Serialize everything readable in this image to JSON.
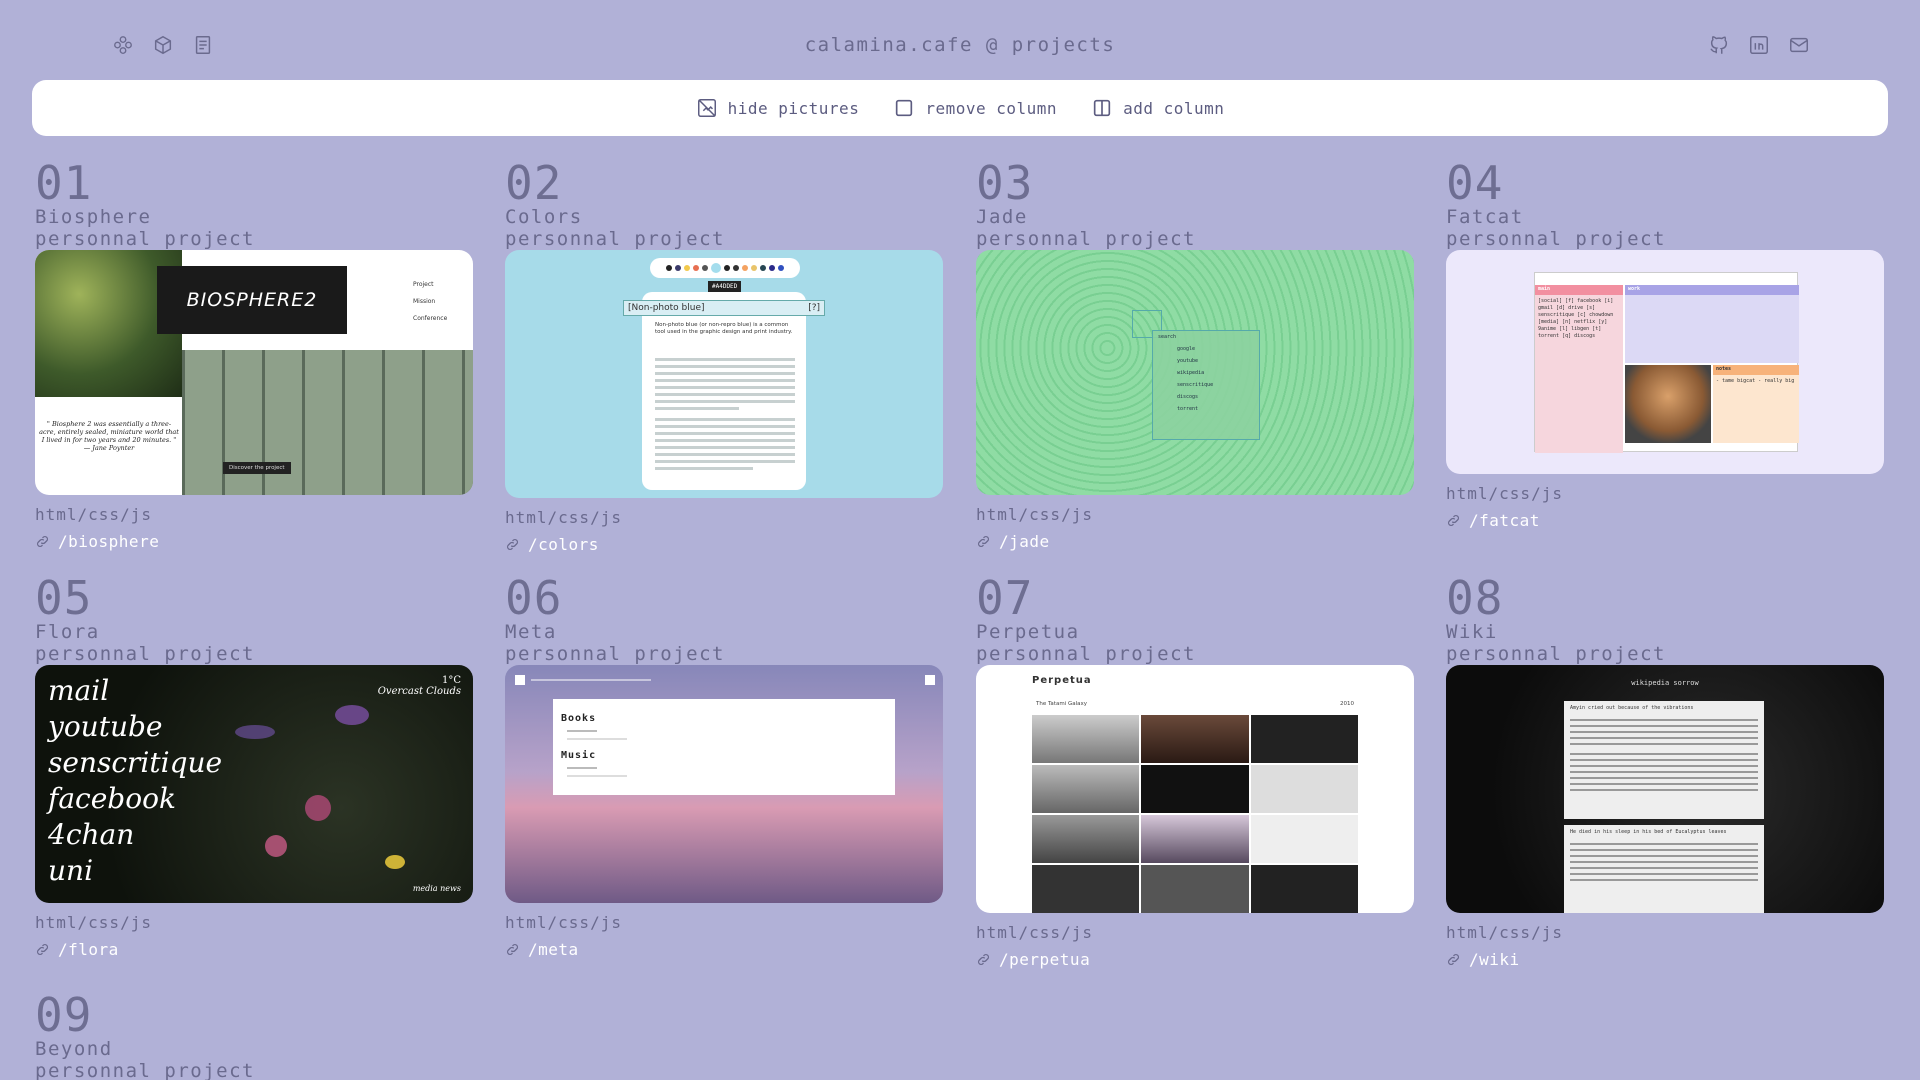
{
  "header": {
    "title": "calamina.cafe @ projects",
    "left_icons": [
      "flower-icon",
      "cube-icon",
      "document-icon"
    ],
    "social_icons": [
      "github-icon",
      "linkedin-icon",
      "mail-icon"
    ]
  },
  "toolbar": {
    "hide_pictures": "hide pictures",
    "remove_column": "remove column",
    "add_column": "add column"
  },
  "projects": [
    {
      "num": "01",
      "name": "Biosphere",
      "type": "personnal project",
      "tech": "html/css/js",
      "link": "/biosphere",
      "thumb": {
        "logo": "BIOSPHERE2",
        "menu": [
          "Project",
          "Mission",
          "Conference"
        ],
        "quote": "\" Biosphere 2 was essentially a three-acre, entirely sealed, miniature world that I lived in for two years and 20 minutes. \" — Jane Poynter",
        "button": "Discover the project"
      }
    },
    {
      "num": "02",
      "name": "Colors",
      "type": "personnal project",
      "tech": "html/css/js",
      "link": "/colors",
      "thumb": {
        "hex": "#A4DDED",
        "label": "[Non-photo blue]",
        "help": "[?]",
        "caption": "Non-photo blue (or non-repro blue) is a common tool used in the graphic design and print industry."
      }
    },
    {
      "num": "03",
      "name": "Jade",
      "type": "personnal project",
      "tech": "html/css/js",
      "link": "/jade",
      "thumb": {
        "search": "search",
        "items": [
          "google",
          "youtube",
          "wikipedia",
          "senscritique",
          "discogs",
          "torrent"
        ]
      }
    },
    {
      "num": "04",
      "name": "Fatcat",
      "type": "personnal project",
      "tech": "html/css/js",
      "link": "/fatcat",
      "thumb": {
        "main": "main",
        "work": "work",
        "notes": "notes",
        "main_items": "[social] [f] facebook [i] gmail [d] drive [s] senscritique [c] chowdown [media] [n] netflix [y] 9anime [l] libgen [t] torrent [q] discogs",
        "notes_text": "- tame bigcat - really big"
      }
    },
    {
      "num": "05",
      "name": "Flora",
      "type": "personnal project",
      "tech": "html/css/js",
      "link": "/flora",
      "thumb": {
        "links": [
          "mail",
          "youtube",
          "senscritique",
          "facebook",
          "4chan",
          "uni"
        ],
        "temp": "1°C",
        "weather": "Overcast Clouds",
        "footer": "media   news"
      }
    },
    {
      "num": "06",
      "name": "Meta",
      "type": "personnal project",
      "tech": "html/css/js",
      "link": "/meta",
      "thumb": {
        "sections": [
          "Books",
          "Music"
        ]
      }
    },
    {
      "num": "07",
      "name": "Perpetua",
      "type": "personnal project",
      "tech": "html/css/js",
      "link": "/perpetua",
      "thumb": {
        "title": "Perpetua",
        "subtitle": "The Tatami Galaxy",
        "year": "2010"
      }
    },
    {
      "num": "08",
      "name": "Wiki",
      "type": "personnal project",
      "tech": "html/css/js",
      "link": "/wiki",
      "thumb": {
        "title": "wikipedia sorrow",
        "entries": [
          "Amyin cried out because of the vibrations",
          "He died in his sleep in his bed of Eucalyptus leaves"
        ]
      }
    },
    {
      "num": "09",
      "name": "Beyond",
      "type": "personnal project"
    }
  ]
}
